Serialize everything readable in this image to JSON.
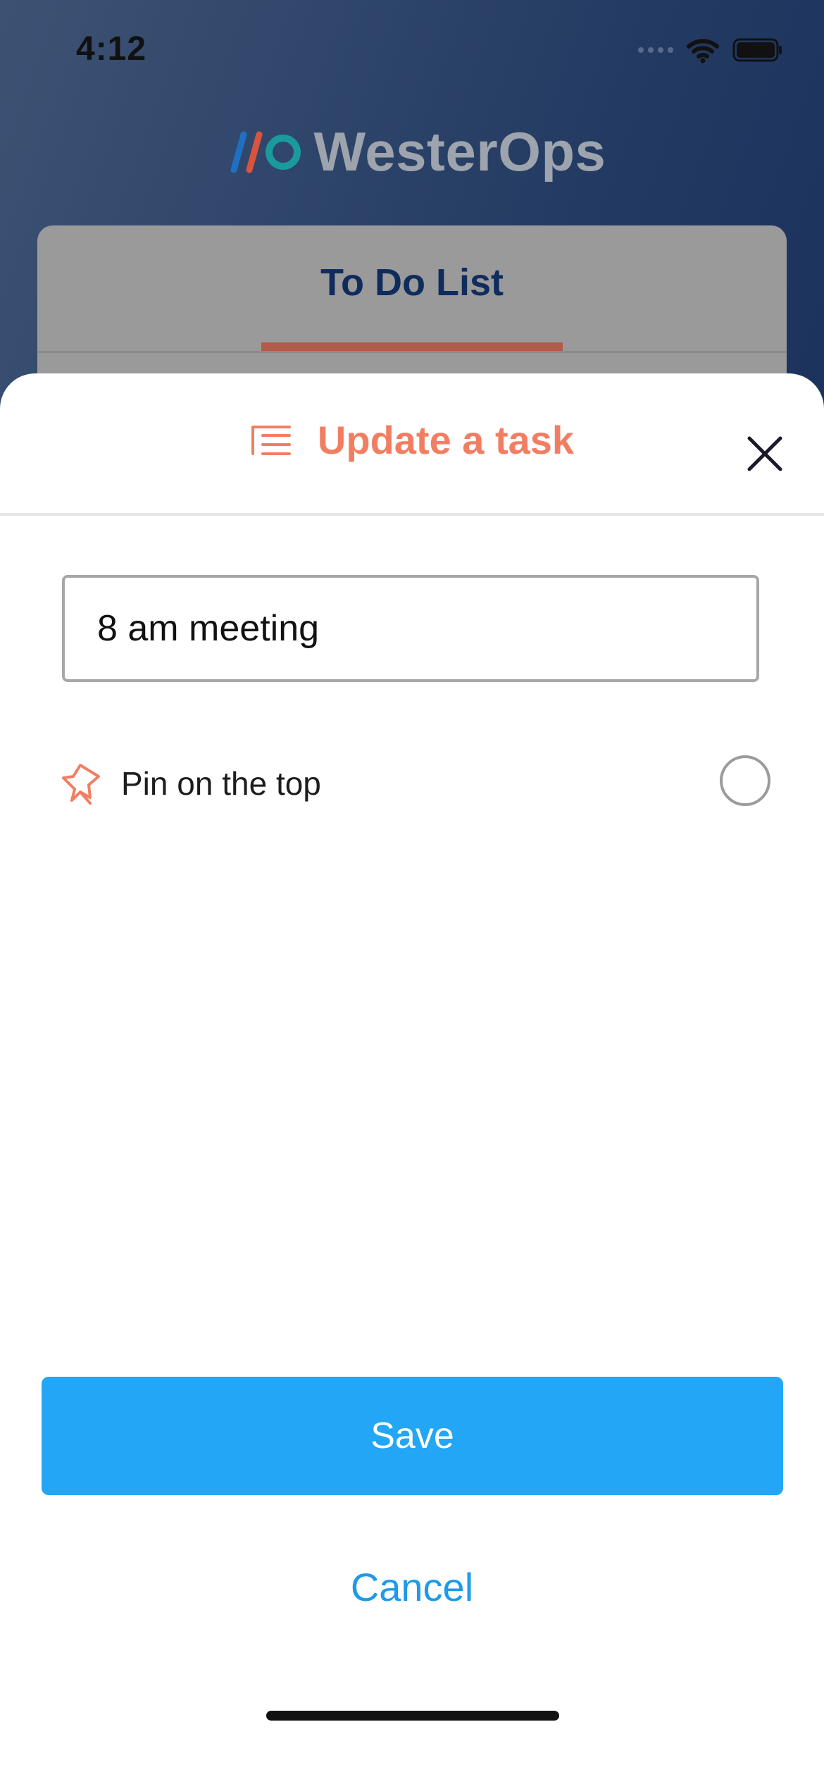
{
  "status_bar": {
    "time": "4:12",
    "icons": [
      "signal-icon",
      "wifi-icon",
      "battery-icon"
    ]
  },
  "header": {
    "logo_text": "WesterOps",
    "logo_icon": "westerops-logo-icon"
  },
  "background_card": {
    "title": "To Do List"
  },
  "sheet": {
    "title": "Update a task",
    "title_icon": "list-icon",
    "close_icon": "close-icon"
  },
  "task": {
    "value": "8 am meeting"
  },
  "pin": {
    "label": "Pin on the top",
    "icon": "pin-icon",
    "selected": false
  },
  "actions": {
    "save_label": "Save",
    "cancel_label": "Cancel"
  },
  "colors": {
    "accent": "#f27e62",
    "primary_button": "#22a6f5",
    "link": "#1e9ae8",
    "background_top": "#3d5273",
    "background_bottom": "#0f2656",
    "tab_indicator": "#b45a48"
  }
}
